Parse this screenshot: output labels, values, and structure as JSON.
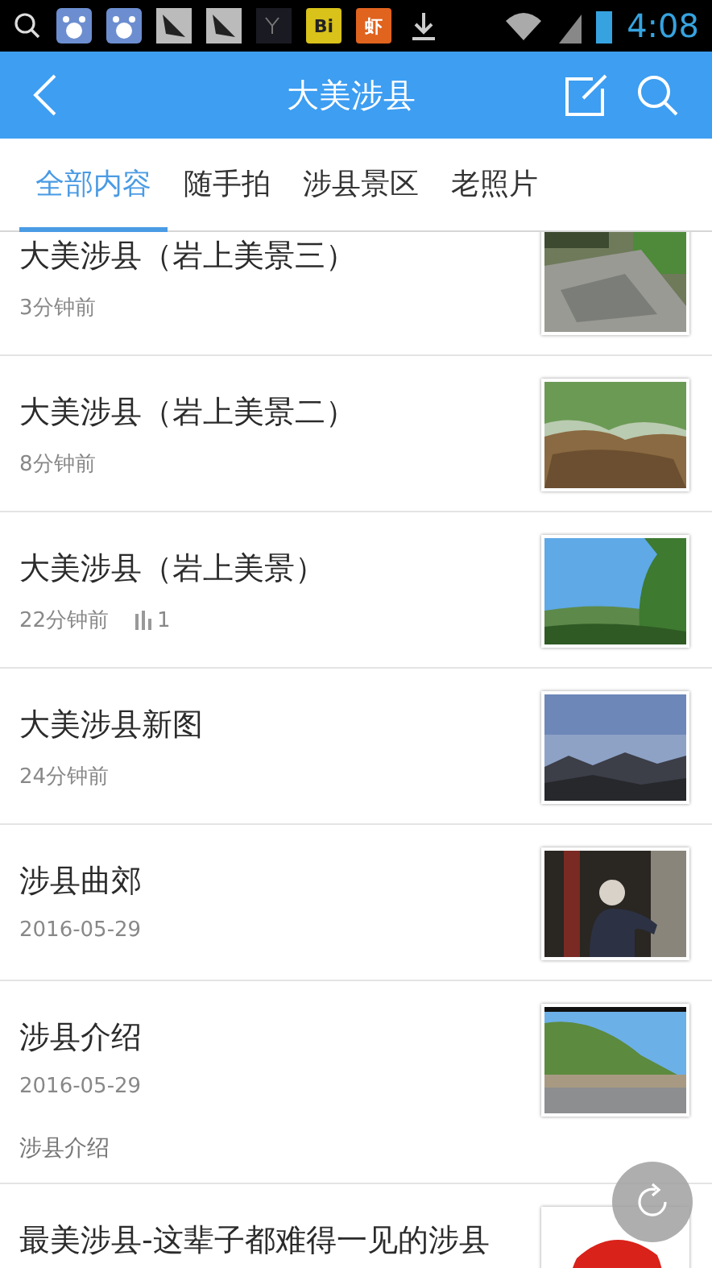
{
  "status_bar": {
    "notifications": [
      "Bi",
      "虾"
    ],
    "time": "4:08"
  },
  "header": {
    "title": "大美涉县"
  },
  "tabs": [
    {
      "label": "全部内容",
      "selected": true
    },
    {
      "label": "随手拍",
      "selected": false
    },
    {
      "label": "涉县景区",
      "selected": false
    },
    {
      "label": "老照片",
      "selected": false
    }
  ],
  "posts": [
    {
      "title": "大美涉县（岩上美景三）",
      "time": "3分钟前"
    },
    {
      "title": "大美涉县（岩上美景二）",
      "time": "8分钟前"
    },
    {
      "title": "大美涉县（岩上美景）",
      "time": "22分钟前",
      "views": "1"
    },
    {
      "title": "大美涉县新图",
      "time": "24分钟前"
    },
    {
      "title": "涉县曲郊",
      "time": "2016-05-29"
    },
    {
      "title": "涉县介绍",
      "time": "2016-05-29",
      "description": "涉县介绍"
    },
    {
      "title": "最美涉县-这辈子都难得一见的涉县"
    }
  ]
}
